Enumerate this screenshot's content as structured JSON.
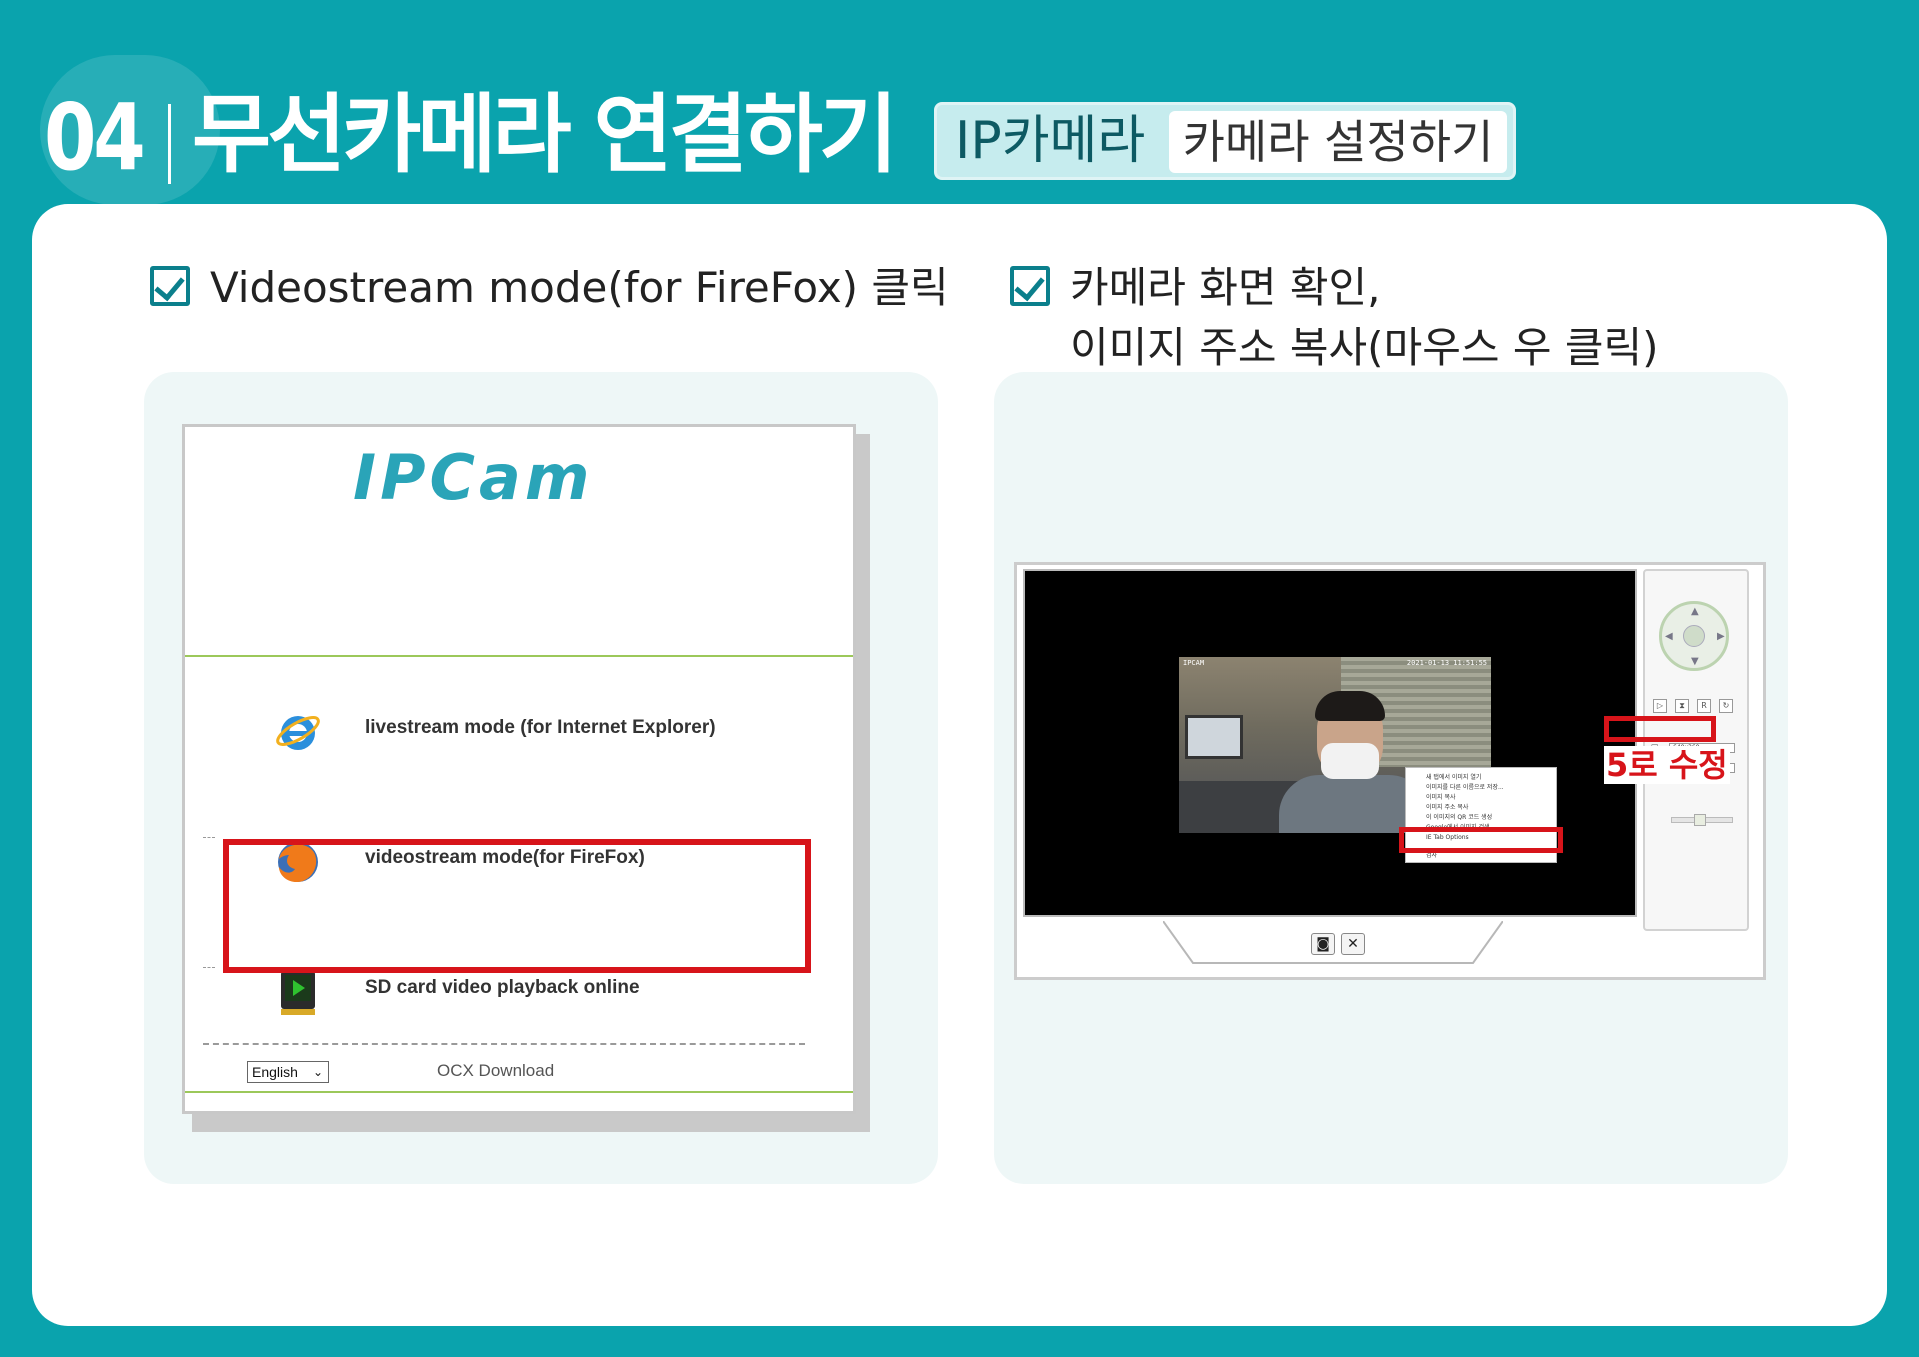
{
  "header": {
    "section_number": "04",
    "title": "무선카메라 연결하기",
    "tag_main": "IP카메라",
    "tag_sub": "카메라 설정하기"
  },
  "steps": [
    {
      "text": "Videostream mode(for FireFox) 클릭"
    },
    {
      "line1": "카메라 화면 확인,",
      "line2": "이미지 주소 복사(마우스 우 클릭)"
    }
  ],
  "ipcam_page": {
    "logo": "IPCam",
    "modes": [
      {
        "label": "livestream mode (for Internet Explorer)",
        "icon": "internet-explorer-icon"
      },
      {
        "label": "videostream mode(for FireFox)",
        "icon": "firefox-icon"
      },
      {
        "label": "SD card video playback online",
        "icon": "sd-card-video-icon"
      }
    ],
    "language_selected": "English",
    "ocx_download": "OCX Download"
  },
  "viewer": {
    "osd_left": "IPCAM",
    "osd_right": "2021-01-13  11:51:55",
    "context_menu": [
      "새 탭에서 이미지 열기",
      "이미지를 다른 이름으로 저장...",
      "이미지 복사",
      "이미지 주소 복사",
      "이 이미지의 QR 코드 생성",
      "Google에서 이미지 검색",
      "IE Tab Options",
      "검사"
    ],
    "resolution": "640x360",
    "fps": "15",
    "fix_note": "5로 수정"
  },
  "colors": {
    "background": "#0aa3ad",
    "accent": "#0b7f8c",
    "highlight_red": "#d7141a"
  }
}
